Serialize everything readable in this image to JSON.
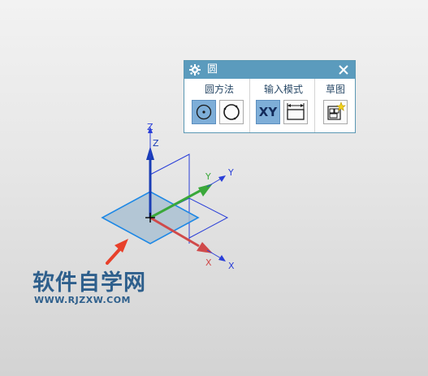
{
  "dialog": {
    "title": "圆",
    "groups": [
      {
        "label": "圆方法",
        "buttons": [
          "center-point-icon",
          "three-point-circle-icon"
        ]
      },
      {
        "label": "输入模式",
        "buttons": [
          "XY",
          "parameter-mode-icon"
        ]
      },
      {
        "label": "草图",
        "buttons": [
          "sketch-palette-icon"
        ]
      }
    ],
    "xy_label": "XY"
  },
  "axes": {
    "z_label": "Z",
    "z_label_2": "Z",
    "y_label": "Y",
    "y_label_2": "Y",
    "x_label": "X",
    "x_label_2": "X"
  },
  "watermark": {
    "main": "软件自学网",
    "url": "WWW.RJZXW.COM"
  },
  "colors": {
    "title_bar": "#5b9bbd",
    "selected_button": "#7eaed8",
    "x_axis": "#d04a4a",
    "y_axis": "#3aa83a",
    "z_axis": "#1e3fbf",
    "plane": "#1e88e5",
    "watermark": "#2e5f8c",
    "arrow": "#e8402a"
  }
}
